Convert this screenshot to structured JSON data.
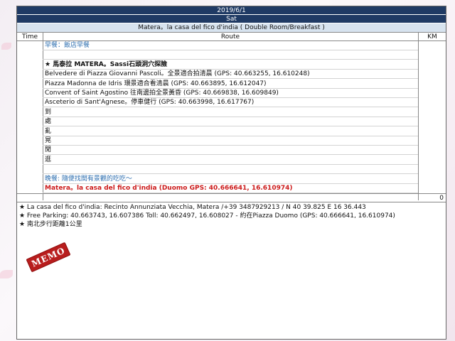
{
  "header": {
    "date": "2019/6/1",
    "weekday": "Sat",
    "hotel": "Matera。la casa del fico d'india ( Double Room/Breakfast )"
  },
  "columns": {
    "time": "Time",
    "route": "Route",
    "km": "KM"
  },
  "route_lines": [
    {
      "text": "早餐：飯店早餐",
      "style": "blue"
    },
    {
      "text": "",
      "style": ""
    },
    {
      "text": "★ 馬泰拉 MATERA。Sassi石頭洞穴探險",
      "style": "bold"
    },
    {
      "text": "Belvedere di Piazza Giovanni Pascoli。全景適合拍清晨 (GPS: 40.663255, 16.610248)",
      "style": ""
    },
    {
      "text": "Piazza Madonna de Idris 環景適合看清晨 (GPS: 40.663895, 16.612047)",
      "style": ""
    },
    {
      "text": "Convent of Saint Agostino 往南邊拍全景黃昏 (GPS: 40.669838, 16.609849)",
      "style": ""
    },
    {
      "text": "Asceterio di Sant'Agnese。停車健行 (GPS: 40.663998, 16.617767)",
      "style": ""
    },
    {
      "text": "到",
      "style": ""
    },
    {
      "text": "處",
      "style": ""
    },
    {
      "text": "亂",
      "style": ""
    },
    {
      "text": "晃",
      "style": ""
    },
    {
      "text": "閒",
      "style": ""
    },
    {
      "text": "逛",
      "style": ""
    },
    {
      "text": "",
      "style": ""
    },
    {
      "text": "晚餐: 隨便找間有景觀的吃吃～",
      "style": "blue"
    },
    {
      "text": "Matera。la casa del fico d'india (Duomo GPS: 40.666641, 16.610974)",
      "style": "red"
    }
  ],
  "km_total": "0",
  "memo": [
    "★ La casa del fico d'india: Recinto Annunziata Vecchia, Matera /+39 3487929213 / N 40 39.825 E 16 36.443",
    "★ Free Parking: 40.663743, 16.607386 Toll: 40.662497, 16.608027 - 約在Piazza Duomo (GPS: 40.666641, 16.610974)",
    "★ 南北步行距離1公里"
  ],
  "memo_stamp": "MEMO"
}
